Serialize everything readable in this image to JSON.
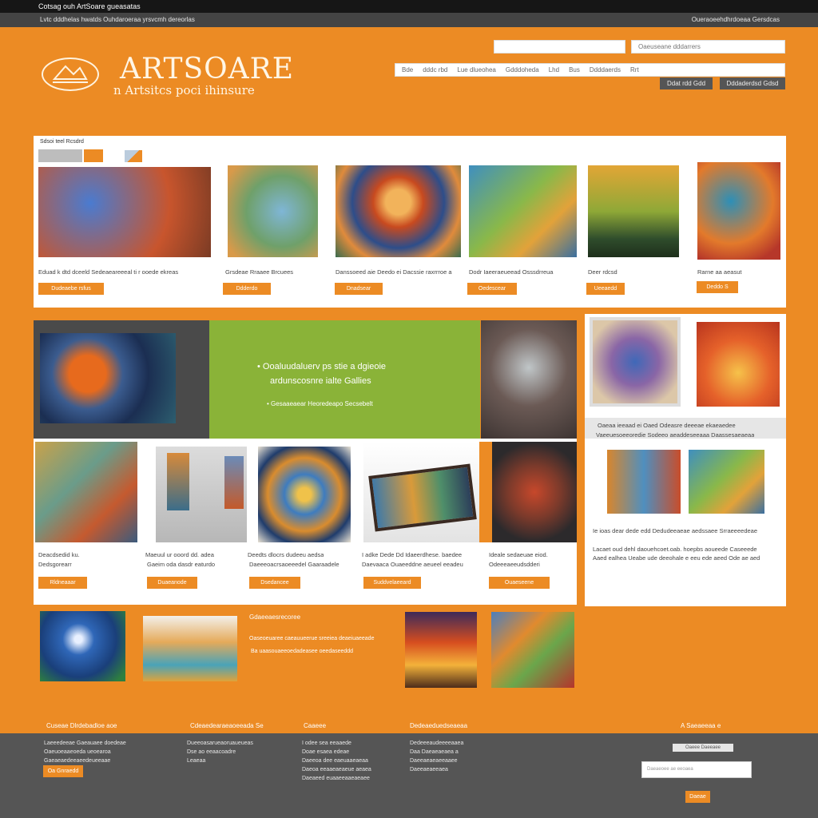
{
  "topbar": {
    "text": "Cotsag ouh ArtSoare gueasatas",
    "sub_left": "Lvtc dddhelas hwatds Ouhdaroeraa yrsvcmh dereorlas",
    "sub_right": "Oueraoeehdhrdoeaa Gersdcas"
  },
  "brand": {
    "name": "ARTSOARE",
    "tagline": "n Artsitcs poci ihinsure"
  },
  "header": {
    "search_placeholder": "",
    "account_placeholder": "Oaeuseane dddarrers",
    "nav": [
      "Bde",
      "dddc rbd",
      "Lue dlueohea",
      "Gdddoheda",
      "Lhd",
      "Bus",
      "Ddddaerds",
      "Rrt"
    ],
    "btn_login": "Ddat rdd Gdd",
    "btn_signup": "Dddaderdsd Gdsd"
  },
  "featured": {
    "section_title": "Sdsoi teel Rcsdrd",
    "items": [
      {
        "caption": "Eduad k dtd dceeld Sedeaeareeeal ti r ooede ekreas",
        "button": "Dudeaebe rsfus"
      },
      {
        "caption": "Grsdeae Rraaee Brcuees",
        "button": "Ddderdo"
      },
      {
        "caption": "Danssoeed aie Deedo ei Dacssie raxrrroe a",
        "button": "Dnadsear"
      },
      {
        "caption": "Dodr Iaeeraeueead Osssdrreua",
        "button": "Oedescear"
      },
      {
        "caption": "Deer rdcsd",
        "button": "Ueeaedd"
      },
      {
        "caption": "Rarne aa aeasut",
        "button": "Deddo S"
      }
    ]
  },
  "promo": {
    "line1": "Ooaluudaluerv ps stie a dgieoie",
    "line2": "ardunscosnre ialte Gallies",
    "line3": "Gesaaeaear Heoredeapo Secsebelt"
  },
  "gallery": {
    "items": [
      {
        "title": "Deacdsedid ku.",
        "sub": "Dedsgorearr",
        "button": "Rldneaaar"
      },
      {
        "title": "Maeuul ur ooord dd. adea",
        "sub": "Gaeim oda dasdr eaturdo",
        "button": "Duaeanode"
      },
      {
        "title": "Deedts dlocrs dudeeu aedsa",
        "sub": "Daeeeoacrsaoeeedel Gaaraadele",
        "button": "Dsedancee"
      },
      {
        "title": "I adke Dede Dd Idaeerdhese. baedee",
        "sub": "Daevaaca Ouaeeddne aeueel eeadeu",
        "button": "Suddvelaeeard"
      },
      {
        "title": "Ideale sedaeuae eiod.",
        "sub": "Odeeeaeeudsdderi",
        "button": "Ouaeseene"
      }
    ]
  },
  "side": {
    "cap1": "Oaeaa ieeaad ei Oaed Odeasre deeeae ekaeaedee",
    "cap2": "Vaeeuesoeeoredie Sodeeo aeaddeseeaaa Daassesaeaeaa",
    "cap3": "Ie ioas dear dede edd Dedudeeaeae aedssaee Srraeeeedeae",
    "cap4": "Lacaet oud dehl daouehcoet.oab. hoepbs aoueede Caseeede",
    "cap5": "Aaed ealhea Ueabe ude deeohale e eeu ede aeed Ode ae aed"
  },
  "bottom": {
    "title": "Gdaeeaesrecoree",
    "line1": "Oaseoeuaree caeauueerue sreeiea deaeiuaeeade",
    "line2": "Ba uaasouaeeoedadeasee oeedaseeddd"
  },
  "footer": {
    "cols": [
      {
        "head": "Cuseae Dlrdebadloe aoe",
        "lines": [
          "Laeeedeeae Gaeauaee doedeae",
          "Oaeuoeaaeoeda ueoearoa",
          "Gaeaeaedeeaeedeueeaae"
        ],
        "button": "Oa Gnraedd"
      },
      {
        "head": "Cdeaedearaeaoeeada Se",
        "lines": [
          "Dueeoasarueaoruaueueas",
          "Dse ao eeaacoadre",
          "",
          "Leaeaa"
        ]
      },
      {
        "head": "Caaeee",
        "lines": [
          "I odee sea eeaaede",
          "Doae esaea edeae",
          "",
          "Daeeoa dee eaeuaaeaeaa",
          "Daeoa eeaaeaeaeue aeaea",
          "Daeaeed euaaeeaaeaeaee"
        ]
      },
      {
        "head": "Dedeaeduedseaeaa",
        "lines": [
          "Dedeeeaudeeeeaaea",
          "Daa Daeaeaeaea a",
          "",
          "Daeeaeaeaeeaaee",
          "Daeeaeaeeaea"
        ]
      }
    ],
    "newsletter_head": "A Saeaeeaa e",
    "newsletter_label": "Oaeee Daeeaee",
    "newsletter_placeholder": "Daeaeoee ae eeoaea",
    "subscribe": "Daeae"
  },
  "colors": {
    "accent": "#ec8b24",
    "dark": "#555555",
    "green": "#8ab338"
  }
}
